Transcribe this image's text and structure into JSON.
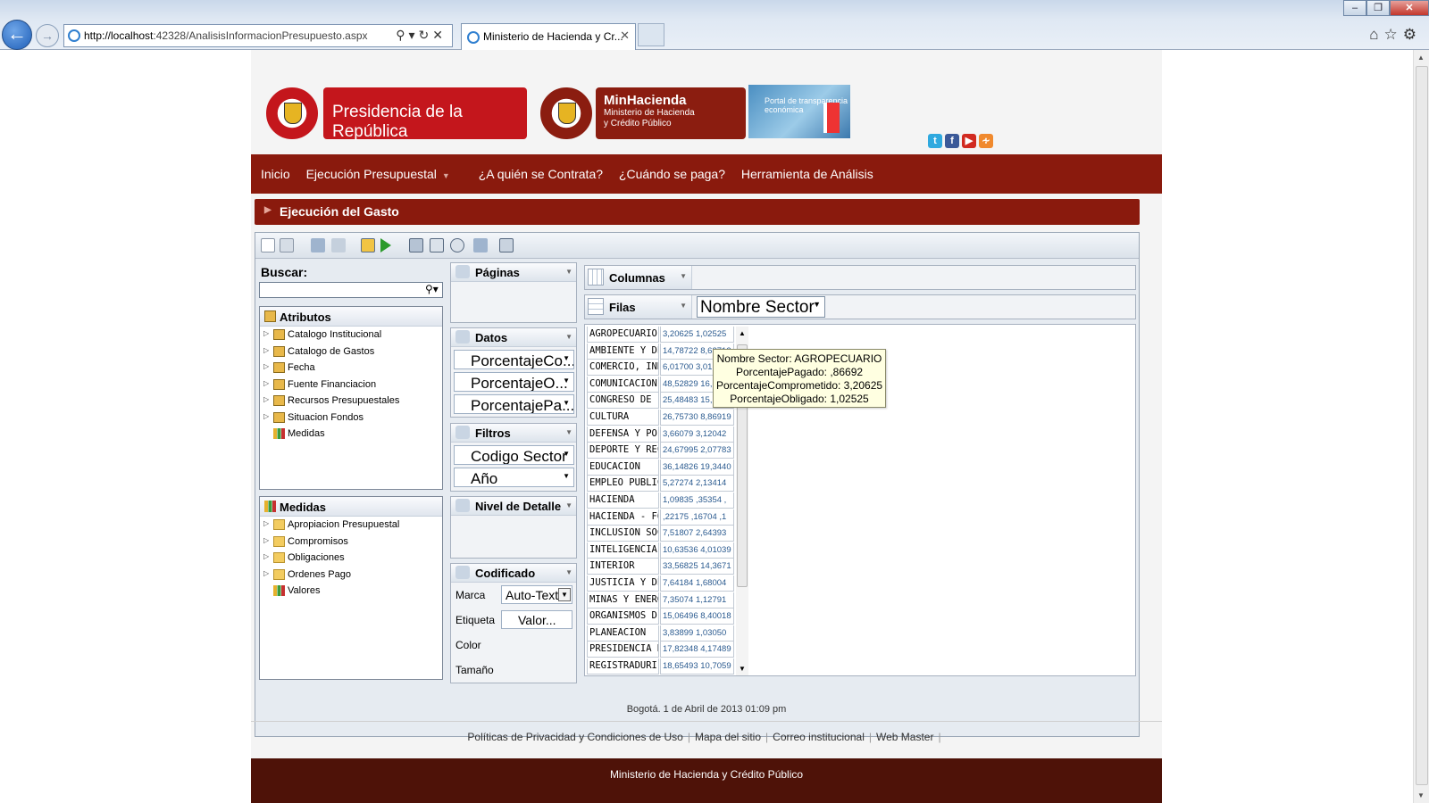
{
  "browser": {
    "url_host": "http://localhost",
    "url_rest": ":42328/AnalisisInformacionPresupuesto.aspx",
    "tab_title": "Ministerio de Hacienda y Cr...",
    "window_buttons": [
      "–",
      "❐",
      "✕"
    ]
  },
  "header": {
    "logo_presidencia": "Presidencia de la República",
    "logo_minhacienda_title": "MinHacienda",
    "logo_minhacienda_sub1": "Ministerio de Hacienda",
    "logo_minhacienda_sub2": "y Crédito Público",
    "logo_portal": "Portal de transparencia económica"
  },
  "nav": {
    "items": [
      "Inicio",
      "Ejecución Presupuestal",
      "¿A quién se Contrata?",
      "¿Cuándo se paga?",
      "Herramienta de Análisis"
    ]
  },
  "section_title": "Ejecución del Gasto",
  "left": {
    "search_label": "Buscar:",
    "search_value": "",
    "attributes_title": "Atributos",
    "attributes": [
      "Catalogo Institucional",
      "Catalogo de Gastos",
      "Fecha",
      "Fuente Financiacion",
      "Recursos Presupuestales",
      "Situacion Fondos",
      "Medidas"
    ],
    "measures_title": "Medidas",
    "measures": [
      "Apropiacion Presupuestal",
      "Compromisos",
      "Obligaciones",
      "Ordenes Pago",
      "Valores"
    ]
  },
  "middle": {
    "paginas": "Páginas",
    "datos": "Datos",
    "datos_items": [
      "PorcentajeCo...",
      "PorcentajeO...",
      "PorcentajePa..."
    ],
    "filtros": "Filtros",
    "filtros_items": [
      "Codigo Sector",
      "Año"
    ],
    "nivel": "Nivel de Detalle",
    "codificado": "Codificado",
    "marca_label": "Marca",
    "marca_value": "Auto-Text",
    "etiqueta_label": "Etiqueta",
    "etiqueta_value": "Valor...",
    "color_label": "Color",
    "tamano_label": "Tamaño"
  },
  "zones": {
    "columnas": "Columnas",
    "filas": "Filas",
    "row_field": "Nombre Sector"
  },
  "grid": {
    "rows": [
      {
        "name": "AGROPECUARIO",
        "values": "3,20625 1,02525"
      },
      {
        "name": "AMBIENTE Y DE",
        "values": "14,78722 8,68713"
      },
      {
        "name": "COMERCIO, IND",
        "values": "6,01700 3,01"
      },
      {
        "name": "COMUNICACION",
        "values": "48,52829 16,"
      },
      {
        "name": "CONGRESO DE",
        "values": "25,48483 15,"
      },
      {
        "name": "CULTURA",
        "values": "26,75730 8,86919"
      },
      {
        "name": "DEFENSA Y POL",
        "values": "3,66079 3,12042"
      },
      {
        "name": "DEPORTE Y REC",
        "values": "24,67995 2,07783"
      },
      {
        "name": "EDUCACION",
        "values": "36,14826 19,3440"
      },
      {
        "name": "EMPLEO PUBLIC",
        "values": "5,27274 2,13414"
      },
      {
        "name": "HACIENDA",
        "values": "1,09835 ,35354 ,"
      },
      {
        "name": "HACIENDA - FO",
        "values": ",22175 ,16704 ,1"
      },
      {
        "name": "INCLUSION SOC",
        "values": "7,51807 2,64393"
      },
      {
        "name": "INTELIGENCIA",
        "values": "10,63536 4,01039"
      },
      {
        "name": "INTERIOR",
        "values": "33,56825 14,3671"
      },
      {
        "name": "JUSTICIA Y DEL",
        "values": "7,64184 1,68004"
      },
      {
        "name": "MINAS Y ENERG",
        "values": "7,35074 1,12791"
      },
      {
        "name": "ORGANISMOS D",
        "values": "15,06496 8,40018"
      },
      {
        "name": "PLANEACION",
        "values": "3,83899 1,03050"
      },
      {
        "name": "PRESIDENCIA D",
        "values": "17,82348 4,17489"
      },
      {
        "name": "REGISTRADURI",
        "values": "18,65493 10,7059"
      }
    ]
  },
  "tooltip": {
    "line1": "Nombre Sector: AGROPECUARIO",
    "line2": "PorcentajePagado: ,86692",
    "line3": "PorcentajeComprometido: 3,20625",
    "line4": "PorcentajeObligado: 1,02525"
  },
  "footer": {
    "date": "Bogotá. 1 de Abril de 2013 01:09 pm",
    "links": [
      "Políticas de Privacidad y Condiciones de Uso",
      "Mapa del sitio",
      "Correo institucional",
      "Web Master"
    ],
    "bottom": "Ministerio de Hacienda y Crédito Público"
  },
  "colors": {
    "nav": "#8a1a0d",
    "brand_red": "#c4161c",
    "footer": "#4e1208",
    "tooltip_bg": "#ffffe1"
  }
}
